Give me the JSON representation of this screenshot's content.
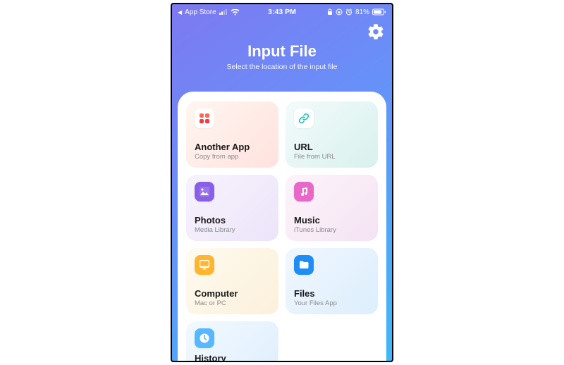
{
  "status": {
    "back_app": "App Store",
    "time": "3:43 PM",
    "battery": "81%"
  },
  "header": {
    "title": "Input File",
    "subtitle": "Select the location of the input file"
  },
  "cards": {
    "another_app": {
      "label": "Another App",
      "sub": "Copy from app"
    },
    "url": {
      "label": "URL",
      "sub": "File from URL"
    },
    "photos": {
      "label": "Photos",
      "sub": "Media Library"
    },
    "music": {
      "label": "Music",
      "sub": "iTunes Library"
    },
    "computer": {
      "label": "Computer",
      "sub": "Mac or PC"
    },
    "files": {
      "label": "Files",
      "sub": "Your Files App"
    },
    "history": {
      "label": "History",
      "sub": ""
    }
  }
}
